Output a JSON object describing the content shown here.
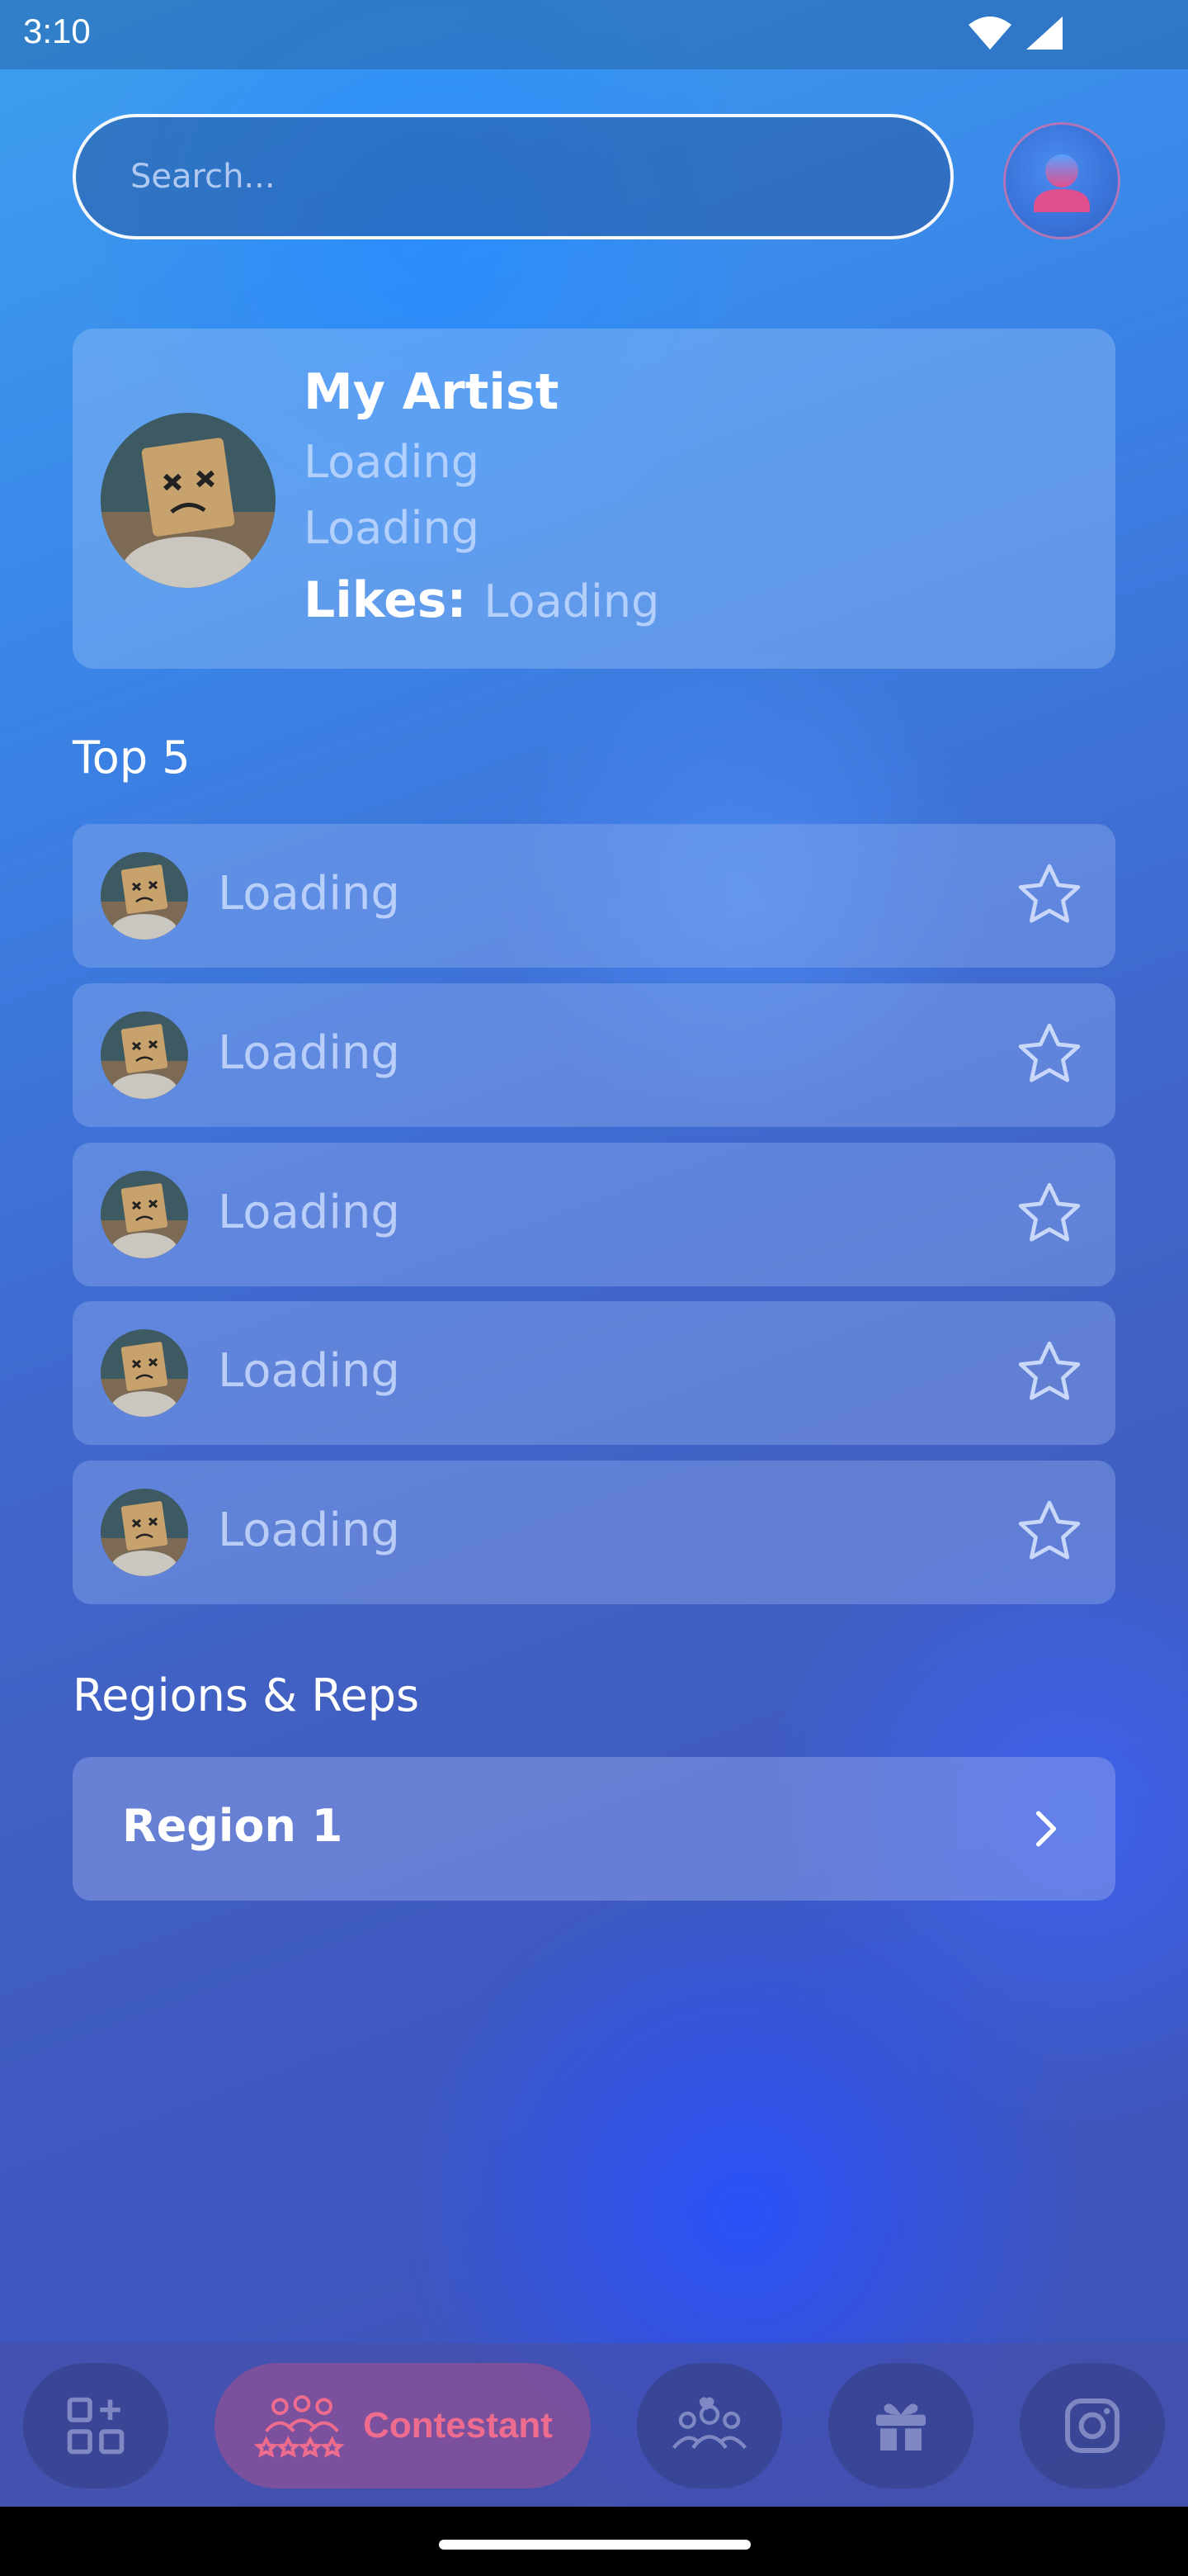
{
  "status_bar": {
    "time": "3:10"
  },
  "search": {
    "placeholder": "Search..."
  },
  "artist_card": {
    "name": "My Artist",
    "line1": "Loading",
    "line2": "Loading",
    "likes_label": "Likes:",
    "likes_value": "Loading"
  },
  "top5": {
    "title": "Top 5",
    "items": [
      {
        "label": "Loading"
      },
      {
        "label": "Loading"
      },
      {
        "label": "Loading"
      },
      {
        "label": "Loading"
      },
      {
        "label": "Loading"
      }
    ]
  },
  "regions": {
    "title": "Regions & Reps",
    "items": [
      {
        "label": "Region 1"
      }
    ]
  },
  "bottom_nav": {
    "active_label": "Contestant",
    "items": [
      "dashboard-icon",
      "contestant-icon",
      "group-icon",
      "gift-icon",
      "instagram-icon"
    ]
  },
  "colors": {
    "accent_pink": "#ee6c8e",
    "nav_bg": "#4650aa"
  }
}
